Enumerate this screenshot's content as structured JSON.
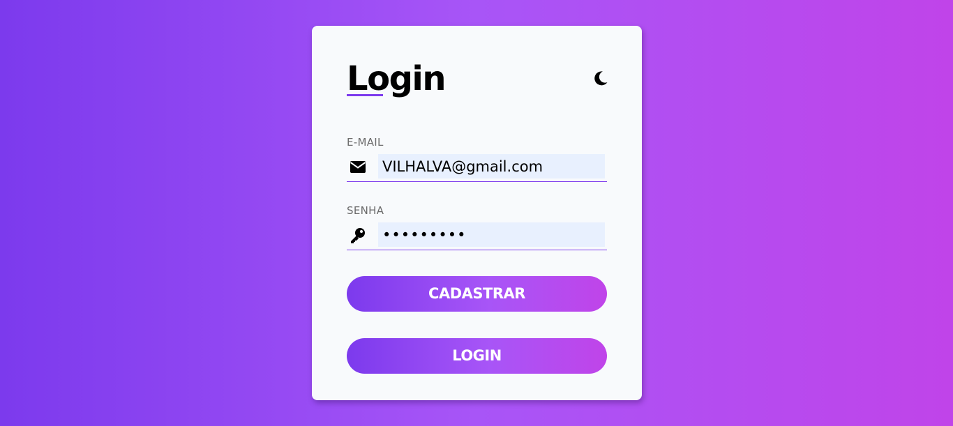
{
  "login_form": {
    "title": "Login",
    "theme_toggle_icon": "moon-icon",
    "email": {
      "label": "E-MAIL",
      "icon": "envelope-icon",
      "value": "VILHALVA@gmail.com"
    },
    "password": {
      "label": "SENHA",
      "icon": "key-icon",
      "value": "•••••••••"
    },
    "register_button": "CADASTRAR",
    "login_button": "LOGIN"
  },
  "colors": {
    "accent": "#7c3aed",
    "accent_end": "#c044e9",
    "card_bg": "#f8fafc",
    "input_bg": "#e8f0fe"
  }
}
